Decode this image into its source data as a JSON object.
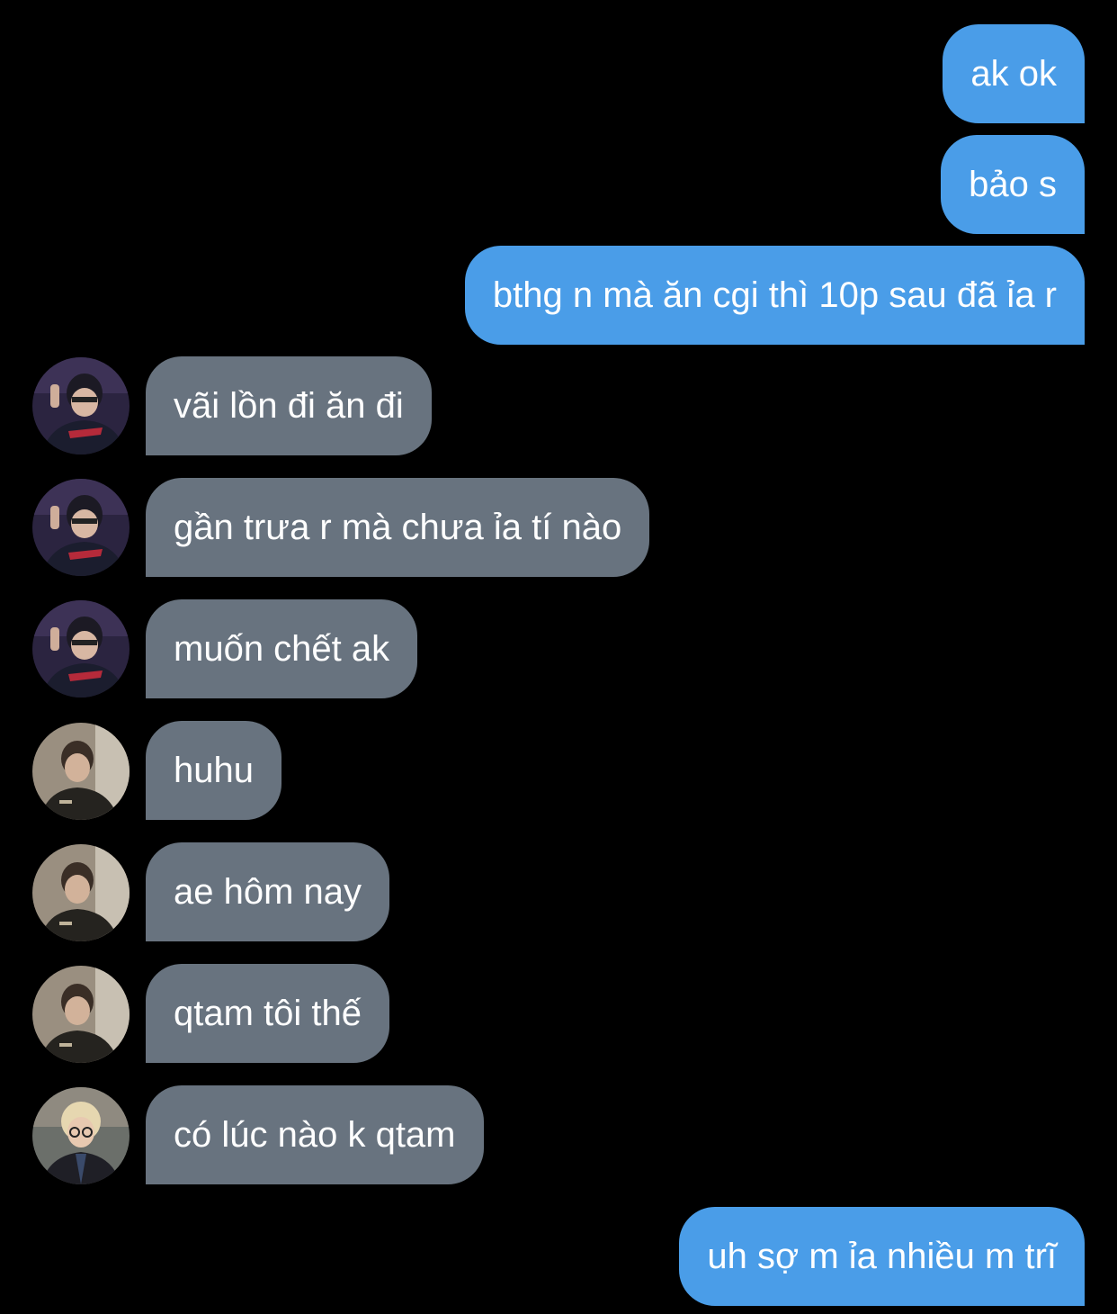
{
  "conversation": {
    "messages": [
      {
        "direction": "out",
        "text": "ak ok"
      },
      {
        "direction": "out",
        "text": "bảo s"
      },
      {
        "direction": "out",
        "text": "bthg n mà ăn cgi thì 10p sau đã ỉa r"
      },
      {
        "direction": "in",
        "avatar": "avatar-dark-jersey-icon",
        "text": "vãi lồn đi ăn đi"
      },
      {
        "direction": "in",
        "avatar": "avatar-dark-jersey-icon",
        "text": "gần trưa r mà chưa ỉa tí nào"
      },
      {
        "direction": "in",
        "avatar": "avatar-dark-jersey-icon",
        "text": "muốn chết ak"
      },
      {
        "direction": "in",
        "avatar": "avatar-warm-portrait-icon",
        "text": "huhu"
      },
      {
        "direction": "in",
        "avatar": "avatar-warm-portrait-icon",
        "text": "ae hôm nay"
      },
      {
        "direction": "in",
        "avatar": "avatar-warm-portrait-icon",
        "text": "qtam tôi thế"
      },
      {
        "direction": "in",
        "avatar": "avatar-blond-glasses-icon",
        "text": "có lúc nào k qtam"
      },
      {
        "direction": "out",
        "text": "uh sợ m ỉa nhiều m trĩ"
      }
    ]
  },
  "colors": {
    "background": "#000000",
    "outgoing_bubble": "#4a9de8",
    "incoming_bubble": "#68737f",
    "text": "#ffffff"
  }
}
